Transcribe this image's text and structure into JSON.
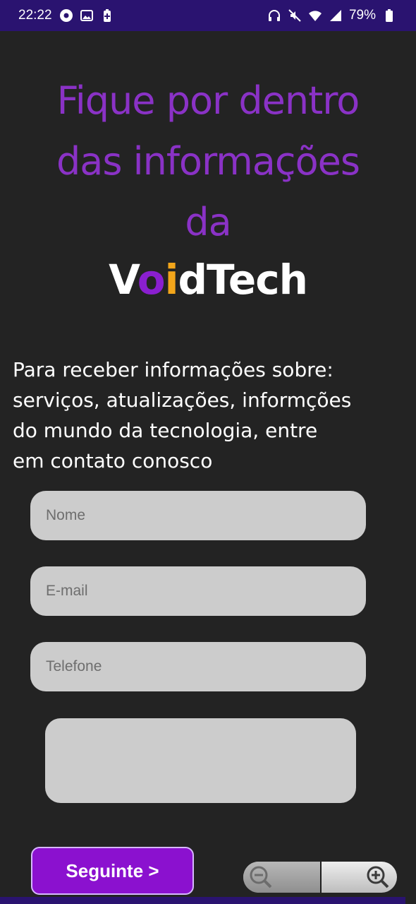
{
  "status_bar": {
    "time": "22:22",
    "battery": "79%",
    "left_icons": [
      "media-icon",
      "image-icon",
      "battery-saver-icon"
    ],
    "right_icons": [
      "headphones-icon",
      "mute-icon",
      "wifi-icon",
      "signal-icon",
      "battery-icon"
    ]
  },
  "header": {
    "line1": "Fique por dentro",
    "line2": "das informações",
    "line3": "da",
    "brand_part1": "V",
    "brand_o": "o",
    "brand_i": "i",
    "brand_part2": "dTech"
  },
  "intro": {
    "line1": "Para receber informações sobre:",
    "line2": "serviços, atualizações, informções",
    "line3": "do mundo da tecnologia, entre",
    "line4": "em contato conosco"
  },
  "form": {
    "name_placeholder": "Nome",
    "email_placeholder": "E-mail",
    "phone_placeholder": "Telefone",
    "message_placeholder": ""
  },
  "actions": {
    "next_label": "Seguinte >"
  },
  "colors": {
    "accent": "#8b11cf",
    "headline": "#8a32c6",
    "status_bar": "#2a1370",
    "background": "#232323",
    "field": "#cccccc",
    "brand_i": "#f2a51a"
  }
}
